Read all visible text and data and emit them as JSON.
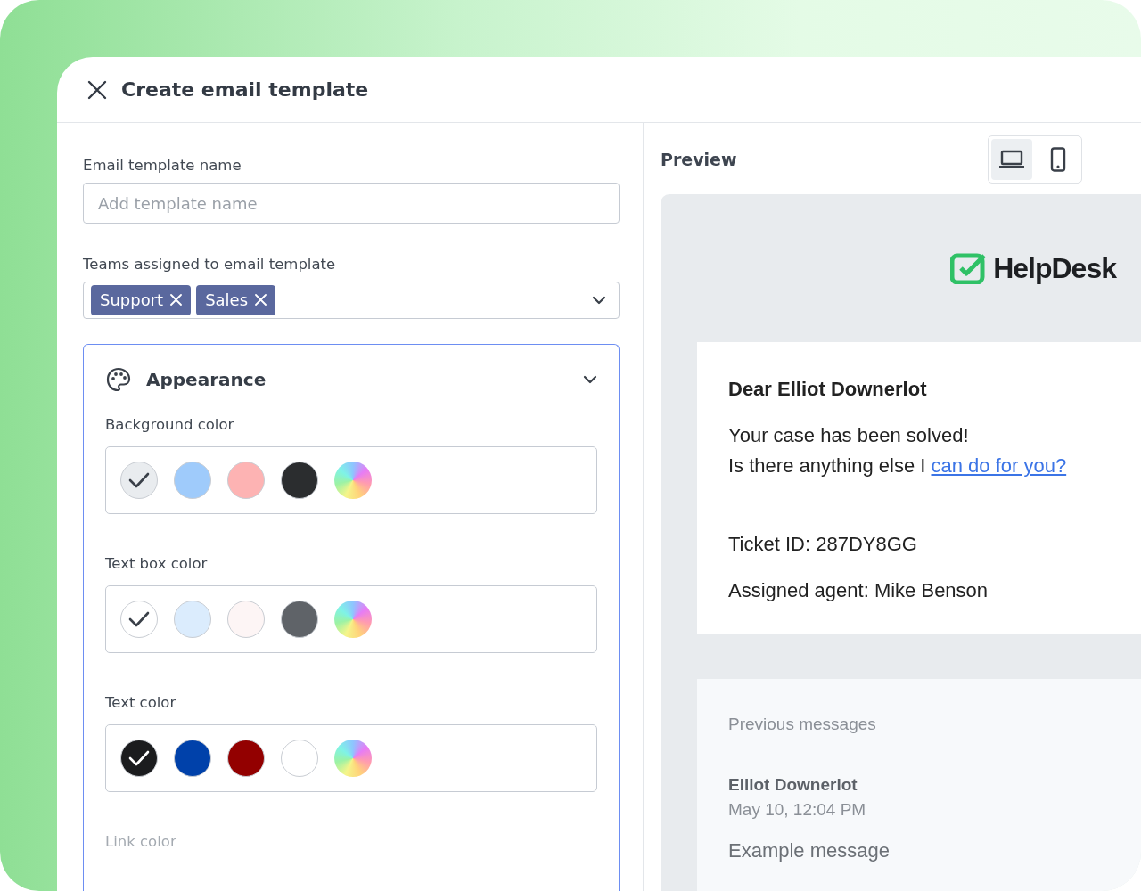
{
  "window": {
    "title": "Create email template"
  },
  "form": {
    "name_field": {
      "label": "Email template name",
      "placeholder": "Add template name"
    },
    "teams_field": {
      "label": "Teams assigned to email template",
      "tags": [
        "Support",
        "Sales"
      ]
    },
    "appearance": {
      "title": "Appearance",
      "expanded": true,
      "groups": [
        {
          "label": "Background color",
          "swatches": [
            {
              "kind": "solid",
              "color": "#e9ecef",
              "selected": true
            },
            {
              "kind": "solid",
              "color": "#9fcbfb",
              "selected": false
            },
            {
              "kind": "solid",
              "color": "#fdb3b3",
              "selected": false
            },
            {
              "kind": "solid",
              "color": "#2b2d2f",
              "selected": false
            },
            {
              "kind": "spectrum",
              "selected": false
            }
          ]
        },
        {
          "label": "Text box color",
          "swatches": [
            {
              "kind": "solid",
              "color": "#ffffff",
              "selected": true
            },
            {
              "kind": "solid",
              "color": "#dbecfd",
              "selected": false
            },
            {
              "kind": "solid",
              "color": "#fdf5f5",
              "selected": false
            },
            {
              "kind": "solid",
              "color": "#5f6368",
              "selected": false
            },
            {
              "kind": "spectrum",
              "selected": false
            }
          ]
        },
        {
          "label": "Text color",
          "swatches": [
            {
              "kind": "solid",
              "color": "#1b1c1e",
              "selected": true
            },
            {
              "kind": "solid",
              "color": "#0041aa",
              "selected": false
            },
            {
              "kind": "solid",
              "color": "#930000",
              "selected": false
            },
            {
              "kind": "solid",
              "color": "#ffffff",
              "selected": false
            },
            {
              "kind": "spectrum",
              "selected": false
            }
          ]
        },
        {
          "label": "Link color"
        }
      ]
    }
  },
  "preview": {
    "title": "Preview",
    "devices": [
      {
        "kind": "desktop",
        "selected": true
      },
      {
        "kind": "mobile",
        "selected": false
      }
    ],
    "logo": {
      "text": "HelpDesk"
    },
    "email": {
      "greeting": "Dear Elliot Downerlot",
      "line_1": "Your case has been solved!",
      "line_2": "Is there anything else I",
      "link": "can do for you?",
      "ticket": "Ticket ID: 287DY8GG",
      "agent": "Assigned agent: Mike Benson"
    },
    "previous": {
      "title": "Previous messages",
      "author": "Elliot Downerlot",
      "time": "May 10, 12:04 PM",
      "message": "Example message"
    }
  }
}
